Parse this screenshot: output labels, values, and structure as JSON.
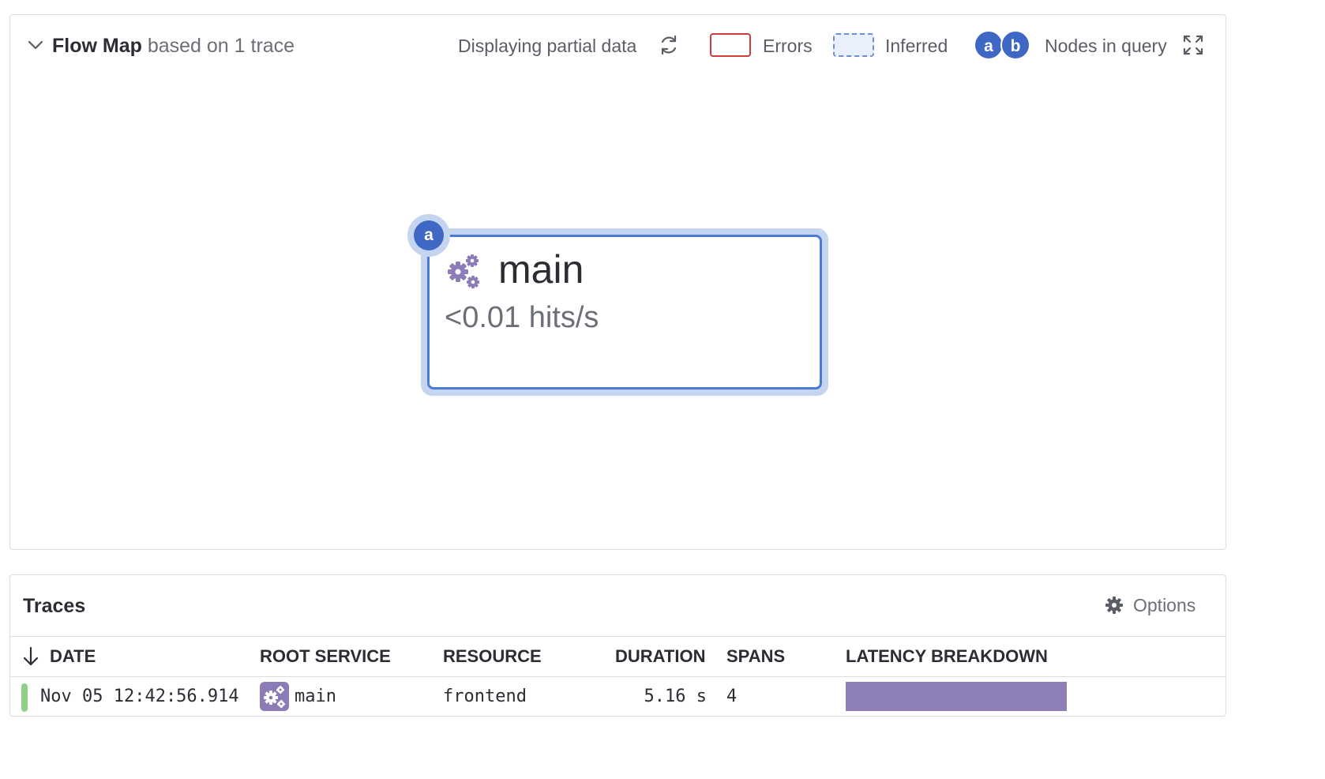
{
  "flow_map": {
    "title": "Flow Map",
    "subtitle": "based on 1 trace",
    "partial_text": "Displaying partial data",
    "legend": {
      "errors_label": "Errors",
      "inferred_label": "Inferred",
      "dot_a": "a",
      "dot_b": "b",
      "nodes_label": "Nodes in query"
    },
    "node": {
      "badge": "a",
      "name": "main",
      "rate": "<0.01 hits/s"
    },
    "colors": {
      "node_border": "#4b7bd3",
      "node_halo": "#c6d5ef",
      "badge": "#3f68c4",
      "errors": "#cf3b3b",
      "inferred": "#6b8fd0",
      "service_icon": "#8b7bb6"
    }
  },
  "traces": {
    "title": "Traces",
    "options_label": "Options",
    "columns": {
      "date": "DATE",
      "root_service": "ROOT SERVICE",
      "resource": "RESOURCE",
      "duration": "DURATION",
      "spans": "SPANS",
      "latency": "LATENCY BREAKDOWN"
    },
    "rows": [
      {
        "date": "Nov 05 12:42:56.914",
        "root_service": "main",
        "resource": "frontend",
        "duration": "5.16 s",
        "spans": "4",
        "status_color": "#8fd08a",
        "latency_color": "#8f7fb8"
      }
    ]
  },
  "icons": [
    "chevron-down-icon",
    "refresh-icon",
    "expand-icon",
    "service-gears-icon",
    "gear-icon",
    "sort-down-arrow-icon"
  ]
}
